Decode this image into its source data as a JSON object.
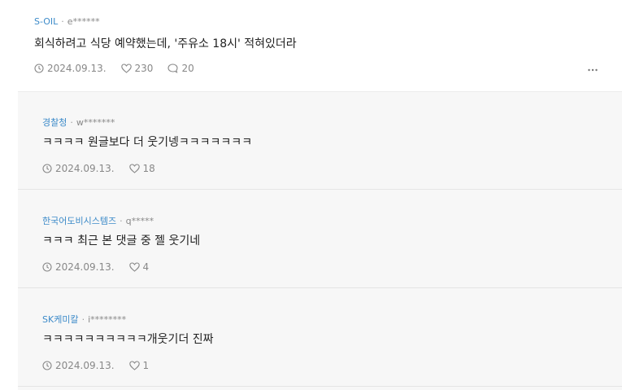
{
  "post": {
    "company": "S-OIL",
    "user": "e******",
    "text": "회식하려고 식당 예약했는데, '주유소 18시' 적혀있더라",
    "date": "2024.09.13.",
    "likes": "230",
    "comments": "20",
    "more_icon": "more-horizontal-icon"
  },
  "comments": [
    {
      "company": "경찰청",
      "user": "w*******",
      "text": "ㅋㅋㅋㅋ 원글보다 더 웃기넹ㅋㅋㅋㅋㅋㅋㅋ",
      "date": "2024.09.13.",
      "likes": "18"
    },
    {
      "company": "한국어도비시스템즈",
      "user": "q*****",
      "text": "ㅋㅋㅋ 최근 본 댓글 중 젤 웃기네",
      "date": "2024.09.13.",
      "likes": "4"
    },
    {
      "company": "SK케미칼",
      "user": "i********",
      "text": "ㅋㅋㅋㅋㅋㅋㅋㅋㅋㅋ개웃기더 진짜",
      "date": "2024.09.13.",
      "likes": "1"
    }
  ],
  "colors": {
    "company": "#3d8bc9",
    "meta": "#888888",
    "text": "#222222",
    "comment_bg": "#f7f7f7"
  },
  "separator": "·"
}
